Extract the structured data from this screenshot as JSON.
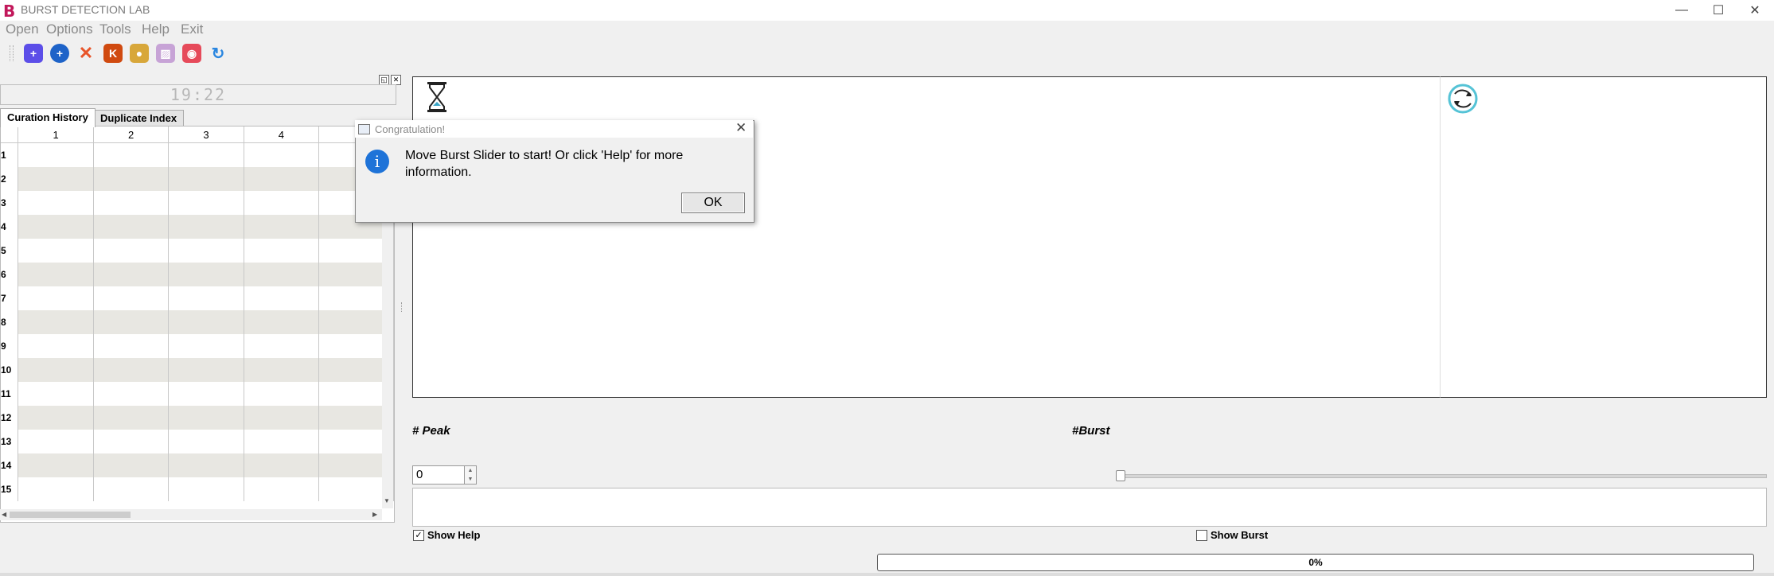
{
  "window": {
    "logo": "B",
    "title": "BURST DETECTION LAB",
    "controls": {
      "minimize": "—",
      "maximize": "☐",
      "close": "✕"
    }
  },
  "menu": [
    "Open",
    "Options",
    "Tools",
    "Help",
    "Exit"
  ],
  "toolbar": [
    {
      "icon": "add-icon",
      "glyph": "+",
      "color": "#5c4ee8"
    },
    {
      "icon": "zoom-in-icon",
      "glyph": "+",
      "color": "#1e63c8"
    },
    {
      "icon": "cross-icon",
      "glyph": "✕",
      "color": "#e8552a"
    },
    {
      "icon": "k-icon",
      "glyph": "K",
      "color": "#d04a10"
    },
    {
      "icon": "gold-icon",
      "glyph": "●",
      "color": "#d8a73a"
    },
    {
      "icon": "image-icon",
      "glyph": "▨",
      "color": "#c7a3d6"
    },
    {
      "icon": "camera-icon",
      "glyph": "◉",
      "color": "#e64a5a"
    },
    {
      "icon": "refresh-icon",
      "glyph": "↻",
      "color": "#2a86e0"
    }
  ],
  "left_panel": {
    "time_display": "19:22",
    "tabs": [
      "Curation History",
      "Duplicate Index"
    ],
    "columns": [
      "1",
      "2",
      "3",
      "4",
      ""
    ],
    "rows": [
      "1",
      "2",
      "3",
      "4",
      "5",
      "6",
      "7",
      "8",
      "9",
      "10",
      "11",
      "12",
      "13",
      "14",
      "15"
    ]
  },
  "controls": {
    "peak_label": "# Peak",
    "burst_label": "#Burst",
    "peak_value": "0",
    "show_help_label": "Show Help",
    "show_help_checked": "✓",
    "show_burst_label": "Show Burst",
    "progress_text": "0%",
    "burst_slider_position": 0
  },
  "dialog": {
    "title": "Congratulation!",
    "close": "✕",
    "info_glyph": "i",
    "message": "Move Burst Slider to start! Or click 'Help' for more information.",
    "ok_label": "OK"
  }
}
